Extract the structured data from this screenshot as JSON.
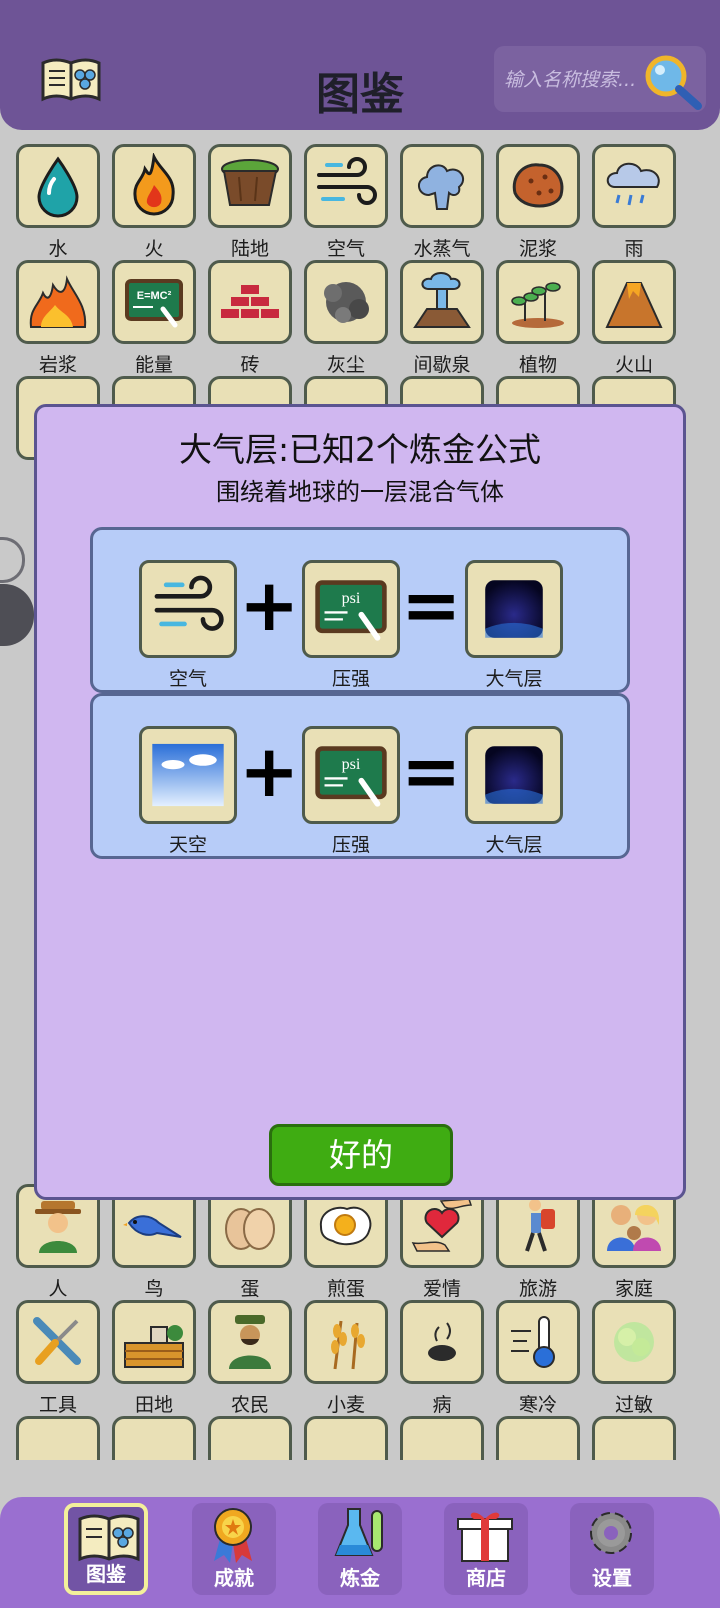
{
  "header": {
    "title": "图鉴",
    "search_placeholder": "输入名称搜索...",
    "book_icon": "book-icon",
    "search_icon": "magnifier-icon"
  },
  "grid": {
    "rows": [
      {
        "items": [
          {
            "label": "水",
            "icon": "water-drop-icon"
          },
          {
            "label": "火",
            "icon": "fire-icon"
          },
          {
            "label": "陆地",
            "icon": "land-icon"
          },
          {
            "label": "空气",
            "icon": "wind-icon"
          },
          {
            "label": "水蒸气",
            "icon": "steam-icon"
          },
          {
            "label": "泥浆",
            "icon": "mud-icon"
          },
          {
            "label": "雨",
            "icon": "rain-icon"
          }
        ]
      },
      {
        "items": [
          {
            "label": "岩浆",
            "icon": "lava-icon"
          },
          {
            "label": "能量",
            "icon": "energy-icon"
          },
          {
            "label": "砖",
            "icon": "brick-icon"
          },
          {
            "label": "灰尘",
            "icon": "dust-icon"
          },
          {
            "label": "间歇泉",
            "icon": "geyser-icon"
          },
          {
            "label": "植物",
            "icon": "plant-icon"
          },
          {
            "label": "火山",
            "icon": "volcano-icon"
          }
        ]
      },
      {
        "items": [
          {
            "label": "人",
            "icon": "person-icon"
          },
          {
            "label": "鸟",
            "icon": "bird-icon"
          },
          {
            "label": "蛋",
            "icon": "eggs-icon"
          },
          {
            "label": "煎蛋",
            "icon": "fried-egg-icon"
          },
          {
            "label": "爱情",
            "icon": "love-icon"
          },
          {
            "label": "旅游",
            "icon": "travel-icon"
          },
          {
            "label": "家庭",
            "icon": "family-icon"
          }
        ]
      },
      {
        "items": [
          {
            "label": "工具",
            "icon": "tools-icon"
          },
          {
            "label": "田地",
            "icon": "field-icon"
          },
          {
            "label": "农民",
            "icon": "farmer-icon"
          },
          {
            "label": "小麦",
            "icon": "wheat-icon"
          },
          {
            "label": "病",
            "icon": "sickness-icon"
          },
          {
            "label": "寒冷",
            "icon": "cold-icon"
          },
          {
            "label": "过敏",
            "icon": "allergy-icon"
          }
        ]
      }
    ]
  },
  "modal": {
    "title": "大气层:已知2个炼金公式",
    "subtitle": "围绕着地球的一层混合气体",
    "recipes": [
      {
        "a": "空气",
        "b": "压强",
        "result": "大气层",
        "a_icon": "wind-icon",
        "b_icon": "pressure-icon",
        "result_icon": "atmosphere-icon"
      },
      {
        "a": "天空",
        "b": "压强",
        "result": "大气层",
        "a_icon": "sky-icon",
        "b_icon": "pressure-icon",
        "result_icon": "atmosphere-icon"
      }
    ],
    "plus": "+",
    "equals": "=",
    "ok_label": "好的",
    "ok_color": "#3fac12"
  },
  "nav": {
    "items": [
      {
        "label": "图鉴",
        "icon": "book-icon",
        "active": true
      },
      {
        "label": "成就",
        "icon": "medal-icon",
        "active": false
      },
      {
        "label": "炼金",
        "icon": "flask-icon",
        "active": false
      },
      {
        "label": "商店",
        "icon": "gift-icon",
        "active": false
      },
      {
        "label": "设置",
        "icon": "gear-icon",
        "active": false
      }
    ]
  },
  "colors": {
    "header": "#6e5496",
    "nav": "#9a6fd0",
    "modal": "#d0b7f0",
    "recipe": "#b7ccf8",
    "tile": "#e9e0b6"
  }
}
